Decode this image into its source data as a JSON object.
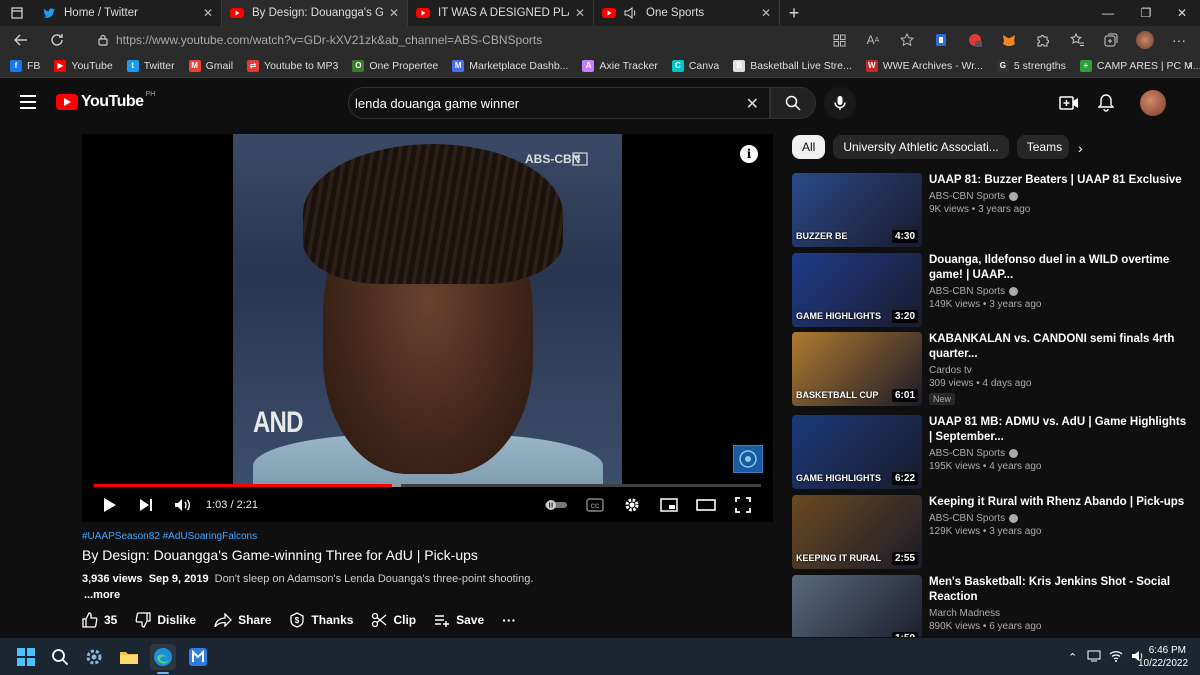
{
  "browser": {
    "tabs": [
      {
        "title": "Home / Twitter",
        "icon": "twitter-icon",
        "active": false
      },
      {
        "title": "By Design: Douangga's Game-wi",
        "icon": "youtube-icon",
        "active": true
      },
      {
        "title": "IT WAS A DESIGNED PLAY (but n",
        "icon": "youtube-icon",
        "active": false
      },
      {
        "title": "One Sports",
        "icon": "youtube-icon",
        "active": false
      }
    ],
    "url": "https://www.youtube.com/watch?v=GDr-kXV21zk&ab_channel=ABS-CBNSports",
    "bookmarks": [
      {
        "label": "FB",
        "color": "#1877f2",
        "glyph": "f"
      },
      {
        "label": "YouTube",
        "color": "#ff0000",
        "glyph": "▶"
      },
      {
        "label": "Twitter",
        "color": "#1d9bf0",
        "glyph": "t"
      },
      {
        "label": "Gmail",
        "color": "#ea4335",
        "glyph": "M"
      },
      {
        "label": "Youtube to MP3",
        "color": "#e53935",
        "glyph": "⇄"
      },
      {
        "label": "One Propertee",
        "color": "#3a7d2c",
        "glyph": "O"
      },
      {
        "label": "Marketplace Dashb...",
        "color": "#4a6cf7",
        "glyph": "M"
      },
      {
        "label": "Axie Tracker",
        "color": "#c77dff",
        "glyph": "A"
      },
      {
        "label": "Canva",
        "color": "#00c4cc",
        "glyph": "C"
      },
      {
        "label": "Basketball Live Stre...",
        "color": "#dddddd",
        "glyph": "B"
      },
      {
        "label": "WWE Archives - Wr...",
        "color": "#c62828",
        "glyph": "W"
      },
      {
        "label": "5 strengths",
        "color": "#333333",
        "glyph": "G"
      },
      {
        "label": "CAMP ARES | PC M...",
        "color": "#2e9e3e",
        "glyph": "+"
      }
    ]
  },
  "youtube": {
    "logo_word": "YouTube",
    "region": "PH",
    "search_query": "lenda douanga game winner"
  },
  "player": {
    "time_current": "1:03",
    "time_total": "2:21",
    "progress_played": 0.447,
    "progress_loaded": 0.46,
    "overlay_text": "AND",
    "broadcaster_logo": "ABS-CBN"
  },
  "video": {
    "hashtags": "#UAAPSeason82 #AdUSoaringFalcons",
    "title": "By Design: Douangga's Game-winning Three for AdU | Pick-ups",
    "views": "3,936 views",
    "date": "Sep 9, 2019",
    "description": "Don't sleep on Adamson's Lenda Douanga's three-point shooting.",
    "more": "...more",
    "actions": {
      "likes": "35",
      "dislike": "Dislike",
      "share": "Share",
      "thanks": "Thanks",
      "clip": "Clip",
      "save": "Save"
    }
  },
  "chips": [
    "All",
    "University Athletic Associati...",
    "Teams"
  ],
  "recommendations": [
    {
      "title": "UAAP 81: Buzzer Beaters | UAAP 81 Exclusive",
      "channel": "ABS-CBN Sports",
      "verified": true,
      "stats": "9K views • 3 years ago",
      "duration": "4:30",
      "thumb_text": "BUZZER BE",
      "bg": "#2a4a8a"
    },
    {
      "title": "Douanga, Ildefonso duel in a WILD overtime game! | UAAP...",
      "channel": "ABS-CBN Sports",
      "verified": true,
      "stats": "149K views • 3 years ago",
      "duration": "3:20",
      "thumb_text": "GAME HIGHLIGHTS",
      "bg": "#1f3c8a"
    },
    {
      "title": "KABANKALAN vs. CANDONI semi finals 4rth quarter...",
      "channel": "Cardos tv",
      "verified": false,
      "stats": "309 views • 4 days ago",
      "duration": "6:01",
      "thumb_text": "BASKETBALL CUP",
      "bg": "#b07a30",
      "badge": "New"
    },
    {
      "title": "UAAP 81 MB: ADMU vs. AdU | Game Highlights | September...",
      "channel": "ABS-CBN Sports",
      "verified": true,
      "stats": "195K views • 4 years ago",
      "duration": "6:22",
      "thumb_text": "GAME HIGHLIGHTS",
      "bg": "#1a3a7a"
    },
    {
      "title": "Keeping it Rural with Rhenz Abando | Pick-ups",
      "channel": "ABS-CBN Sports",
      "verified": true,
      "stats": "129K views • 3 years ago",
      "duration": "2:55",
      "thumb_text": "KEEPING IT RURAL",
      "bg": "#6a4a20"
    },
    {
      "title": "Men's Basketball: Kris Jenkins Shot - Social Reaction",
      "channel": "March Madness",
      "verified": false,
      "stats": "890K views • 6 years ago",
      "duration": "1:59",
      "thumb_text": "",
      "bg": "#5a6a7a"
    }
  ],
  "taskbar": {
    "time": "6:46 PM",
    "date": "10/22/2022"
  },
  "colors": {
    "accent": "#ff0000",
    "link": "#3ea6ff",
    "bg": "#0f0f0f"
  }
}
